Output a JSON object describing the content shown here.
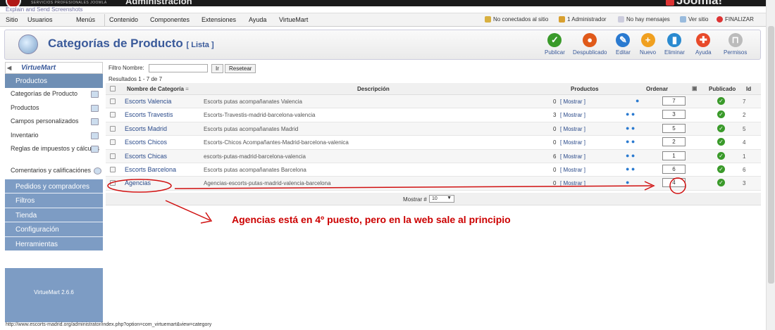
{
  "topbar": {
    "service_text": "SERVICIOS PROFESIONALES JOOMLA",
    "admin_text": "Administración",
    "joomla_text": "Joomla!"
  },
  "explain_text": "Explain and Send Screenshots",
  "menu": [
    "Sitio",
    "Usuarios",
    "Menús",
    "Contenido",
    "Componentes",
    "Extensiones",
    "Ayuda",
    "VirtueMart"
  ],
  "status_right": {
    "visitors": "No conectados al sitio",
    "admins": "1 Administrador",
    "messages": "No hay mensajes",
    "view_site": "Ver sitio",
    "logout": "FINALIZAR"
  },
  "header": {
    "title": "Categorías de Producto",
    "subtitle": "[ Lista ]"
  },
  "toolbar": [
    {
      "label": "Publicar",
      "icon": "check-icon",
      "color": "#3a9a2a",
      "glyph": "✓"
    },
    {
      "label": "Despublicado",
      "icon": "unpublish-icon",
      "color": "#e05a1a",
      "glyph": "●"
    },
    {
      "label": "Editar",
      "icon": "edit-icon",
      "color": "#2a7ad0",
      "glyph": "✎"
    },
    {
      "label": "Nuevo",
      "icon": "new-icon",
      "color": "#f0a020",
      "glyph": "+"
    },
    {
      "label": "Eliminar",
      "icon": "trash-icon",
      "color": "#2a8ad0",
      "glyph": "▮"
    },
    {
      "label": "Ayuda",
      "icon": "help-icon",
      "color": "#e84a2a",
      "glyph": "✚"
    },
    {
      "label": "Permisos",
      "icon": "lock-icon",
      "color": "#bbbbbb",
      "glyph": "⊓"
    }
  ],
  "sidebar": {
    "logo": "VirtueMart",
    "section_active": "Productos",
    "items": [
      "Categorías de Producto",
      "Productos",
      "Campos personalizados",
      "Inventario",
      "Reglas de impuestos y cálculos",
      "Comentarios y calificaciónes"
    ],
    "sections": [
      "Pedidos y compradores",
      "Filtros",
      "Tienda",
      "Configuración",
      "Herramientas"
    ],
    "version": "VirtueMart 2.6.6"
  },
  "filter": {
    "label": "Filtro Nombre:",
    "value": "",
    "go": "Ir",
    "reset": "Resetear"
  },
  "results": "Resultados 1 - 7 de 7",
  "columns": {
    "name": "Nombre de Categoría",
    "desc": "Descripción",
    "products": "Productos",
    "order": "Ordenar",
    "published": "Publicado",
    "id": "Id"
  },
  "rows": [
    {
      "name": "Escorts Valencia",
      "desc": "Escorts putas acompañanates Valencia",
      "products": "0",
      "show": "[ Mostrar ]",
      "order": "7",
      "id": "7"
    },
    {
      "name": "Escorts Travestis",
      "desc": "Escorts-Travestis-madrid-barcelona-valencia",
      "products": "3",
      "show": "[ Mostrar ]",
      "order": "3",
      "id": "2"
    },
    {
      "name": "Escorts Madrid",
      "desc": "Escorts putas acompañanates Madrid",
      "products": "0",
      "show": "[ Mostrar ]",
      "order": "5",
      "id": "5"
    },
    {
      "name": "Escorts Chicos",
      "desc": "Escorts-Chicos Acompañantes-Madrid-barcelona-valenica",
      "products": "0",
      "show": "[ Mostrar ]",
      "order": "2",
      "id": "4"
    },
    {
      "name": "Escorts Chicas",
      "desc": "escorts-putas-madrid-barcelona-valencia",
      "products": "6",
      "show": "[ Mostrar ]",
      "order": "1",
      "id": "1"
    },
    {
      "name": "Escorts Barcelona",
      "desc": "Escorts putas acompañanates Barcelona",
      "products": "0",
      "show": "[ Mostrar ]",
      "order": "6",
      "id": "6"
    },
    {
      "name": "Agencias",
      "desc": "Agencias-escorts-putas-madrid-valencia-barcelona",
      "products": "0",
      "show": "[ Mostrar ]",
      "order": "4",
      "id": "3"
    }
  ],
  "pager": {
    "label": "Mostrar #",
    "value": "10"
  },
  "annotation": "Agencias está en 4º puesto, pero en la web sale al principio",
  "status_url": "http://www.escorts-madrid.org/administrator/index.php?option=com_virtuemart&view=category"
}
